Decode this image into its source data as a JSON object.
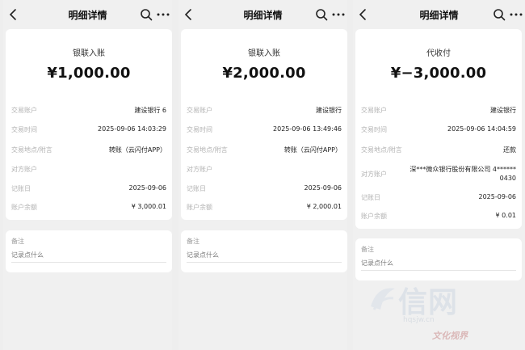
{
  "screens": [
    {
      "nav_title": "明细详情",
      "type_label": "银联入账",
      "amount": "¥1,000.00",
      "rows": [
        {
          "label": "交易账户",
          "value": "建设银行 6"
        },
        {
          "label": "交易时间",
          "value": "2025-09-06 14:03:29"
        },
        {
          "label": "交易地点/附言",
          "value": "转账（云闪付APP）"
        },
        {
          "label": "对方账户",
          "value": ""
        },
        {
          "label": "记账日",
          "value": "2025-09-06"
        },
        {
          "label": "账户余额",
          "value": "¥ 3,000.01"
        }
      ],
      "note_label": "备注",
      "note_placeholder": "记录点什么"
    },
    {
      "nav_title": "明细详情",
      "type_label": "银联入账",
      "amount": "¥2,000.00",
      "rows": [
        {
          "label": "交易账户",
          "value": "建设银行"
        },
        {
          "label": "交易时间",
          "value": "2025-09-06 13:49:46"
        },
        {
          "label": "交易地点/附言",
          "value": "转账（云闪付APP）"
        },
        {
          "label": "对方账户",
          "value": ""
        },
        {
          "label": "记账日",
          "value": "2025-09-06"
        },
        {
          "label": "账户余额",
          "value": "¥ 2,000.01"
        }
      ],
      "note_label": "备注",
      "note_placeholder": "记录点什么"
    },
    {
      "nav_title": "明细详情",
      "type_label": "代收付",
      "amount": "¥−3,000.00",
      "rows": [
        {
          "label": "交易账户",
          "value": "建设银行"
        },
        {
          "label": "交易时间",
          "value": "2025-09-06 14:04:59"
        },
        {
          "label": "交易地点/附言",
          "value": "还款"
        },
        {
          "label": "对方账户",
          "value": "深***微众银行股份有限公司 4******",
          "value2": "0430"
        },
        {
          "label": "记账日",
          "value": "2025-09-06"
        },
        {
          "label": "账户余额",
          "value": "¥ 0.01"
        }
      ],
      "note_label": "备注",
      "note_placeholder": "记录点什么"
    }
  ],
  "watermark": {
    "text": "信网",
    "url": "hqsjw.cn",
    "brand": "文化视界"
  },
  "colors": {
    "background": "#eeeeee",
    "card": "#ffffff",
    "label": "#b2b2b2",
    "value": "#222222"
  }
}
